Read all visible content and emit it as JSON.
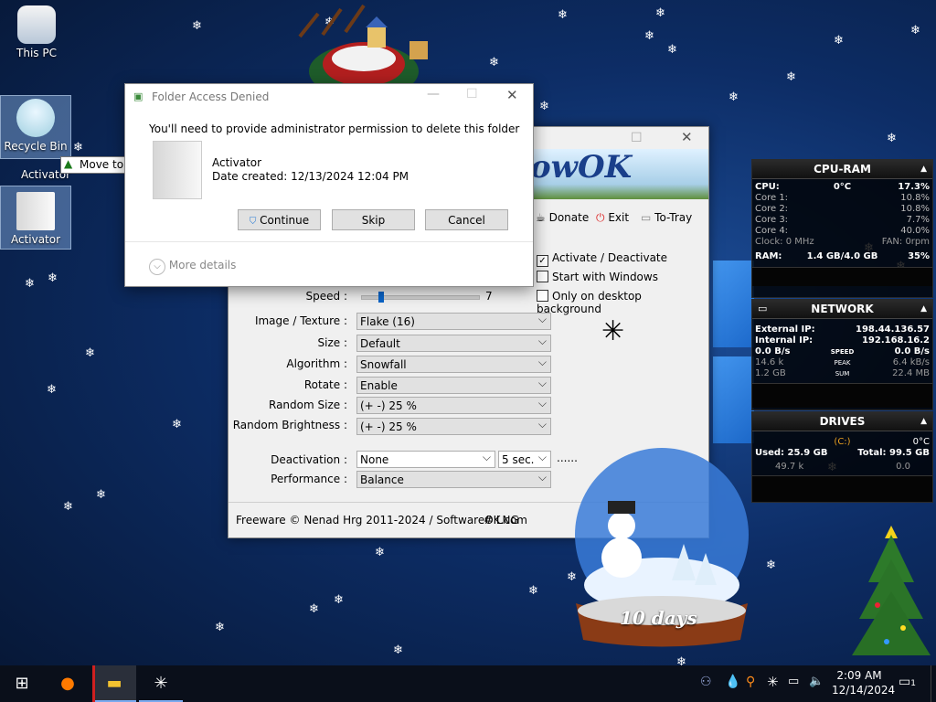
{
  "desktop": {
    "icons": [
      {
        "label": "This PC"
      },
      {
        "label": "Recycle Bin"
      },
      {
        "label": "Activator"
      },
      {
        "label": "Activator"
      }
    ],
    "tooltip": "Move to Recycle Bin"
  },
  "dialog": {
    "title": "Folder Access Denied",
    "message": "You'll need to provide administrator permission to delete this folder",
    "item_name": "Activator",
    "item_date": "Date created: 12/13/2024 12:04 PM",
    "buttons": {
      "continue": "Continue",
      "skip": "Skip",
      "cancel": "Cancel"
    },
    "more_details": "More details"
  },
  "snowfall_window": {
    "banner_text": "owOK",
    "toolbar": {
      "donate": "Donate",
      "exit": "Exit",
      "to_tray": "To-Tray"
    },
    "checkboxes": [
      {
        "label": "Activate / Deactivate",
        "checked": true
      },
      {
        "label": "Start with Windows",
        "checked": false
      },
      {
        "label": "Only on desktop background",
        "checked": false
      }
    ],
    "speed": {
      "label": "Speed :",
      "value": "7",
      "level": 0.15
    },
    "settings": [
      {
        "label": "Image / Texture :",
        "value": "Flake (16)"
      },
      {
        "label": "Size :",
        "value": "Default"
      },
      {
        "label": "Algorithm :",
        "value": "Snowfall"
      },
      {
        "label": "Rotate :",
        "value": "Enable"
      },
      {
        "label": "Random Size :",
        "value": "(+ -) 25 %"
      },
      {
        "label": "Random Brightness :",
        "value": "(+ -) 25 %"
      }
    ],
    "deactivation": {
      "label": "Deactivation :",
      "value": "None",
      "delay": "5 sec.",
      "dots": "......"
    },
    "performance": {
      "label": "Performance :",
      "value": "Balance"
    },
    "footer": {
      "copyright": "Freeware © Nenad Hrg 2011-2024 / SoftwareOK.com",
      "lng": "# LNG"
    }
  },
  "cpu_ram": {
    "title": "CPU-RAM",
    "cpu_label": "CPU:",
    "temp": "0°C",
    "cpu_pct": "17.3%",
    "cores": [
      {
        "label": "Core 1:",
        "value": "10.8%"
      },
      {
        "label": "Core 2:",
        "value": "10.8%"
      },
      {
        "label": "Core 3:",
        "value": "7.7%"
      },
      {
        "label": "Core 4:",
        "value": "40.0%"
      }
    ],
    "clock": "Clock: 0 MHz",
    "fan": "FAN: 0rpm",
    "ram_label": "RAM:",
    "ram_value": "1.4 GB/4.0 GB",
    "ram_pct": "35%"
  },
  "network": {
    "title": "NETWORK",
    "external_label": "External IP:",
    "external_ip": "198.44.136.57",
    "internal_label": "Internal IP:",
    "internal_ip": "192.168.16.2",
    "speed_left": "0.0 B/s",
    "speed_label": "SPEED",
    "speed_right": "0.0 B/s",
    "peak_left": "14.6 k",
    "peak_label": "PEAK",
    "peak_right": "6.4 kB/s",
    "sum_left": "1.2 GB",
    "sum_label": "SUM",
    "sum_right": "22.4 MB"
  },
  "drives": {
    "title": "DRIVES",
    "drive": "(C:)",
    "temp": "0°C",
    "used": "Used: 25.9 GB",
    "total": "Total: 99.5 GB",
    "io_left": "49.7 k",
    "io_right": "0.0"
  },
  "snow_globe": {
    "label": "10 days"
  },
  "taskbar": {
    "time": "2:09 AM",
    "date": "12/14/2024",
    "notification_count": "1"
  }
}
